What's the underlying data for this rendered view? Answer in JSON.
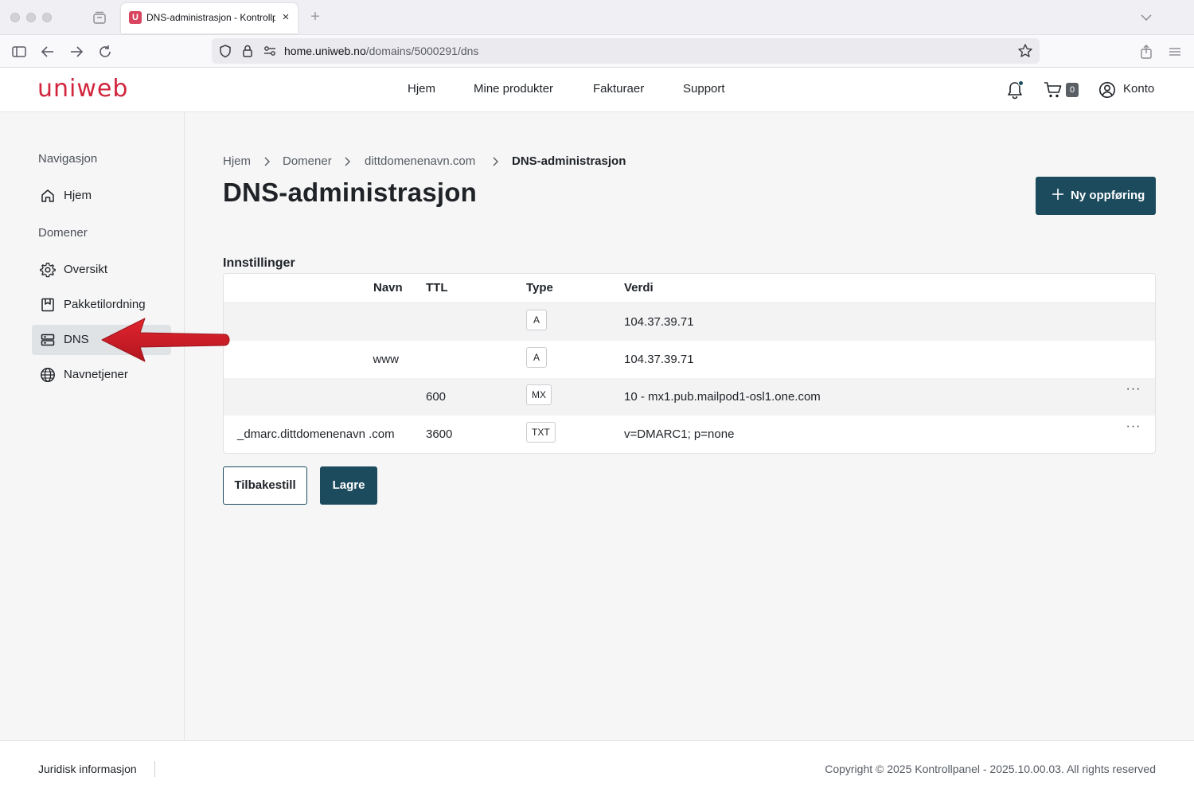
{
  "browser": {
    "tab_title": "DNS-administrasjon - Kontrollpanel",
    "tab_favicon_letter": "U",
    "new_tab_symbol": "+",
    "close_symbol": "×",
    "url_host": "home.uniweb.no",
    "url_path": "/domains/5000291/dns"
  },
  "header": {
    "logo": "uniweb",
    "nav": [
      "Hjem",
      "Mine produkter",
      "Fakturaer",
      "Support"
    ],
    "cart_count": "0",
    "account_label": "Konto"
  },
  "sidebar": {
    "section_nav": "Navigasjon",
    "home_label": "Hjem",
    "section_domains": "Domener",
    "items": [
      {
        "label": "Oversikt",
        "icon": "gear-icon"
      },
      {
        "label": "Pakketilordning",
        "icon": "package-icon"
      },
      {
        "label": "DNS",
        "icon": "server-icon",
        "active": true
      },
      {
        "label": "Navnetjener",
        "icon": "globe-icon"
      }
    ]
  },
  "breadcrumb": [
    "Hjem",
    "Domener",
    "dittdomenenavn.com",
    "DNS-administrasjon"
  ],
  "page_title": "DNS-administrasjon",
  "new_record_label": "Ny oppføring",
  "section_title": "Innstillinger",
  "table": {
    "headers": {
      "name": "Navn",
      "ttl": "TTL",
      "type": "Type",
      "value": "Verdi"
    },
    "rows": [
      {
        "name": "",
        "ttl": "",
        "type": "A",
        "value": "104.37.39.71",
        "menu": ""
      },
      {
        "name": "www",
        "ttl": "",
        "type": "A",
        "value": "104.37.39.71",
        "menu": ""
      },
      {
        "name": "",
        "ttl": "600",
        "type": "MX",
        "value": "10 - mx1.pub.mailpod1-osl1.one.com",
        "menu": "···"
      },
      {
        "name": "_dmarc.dittdomenenavn .com",
        "ttl": "3600",
        "type": "TXT",
        "value": "v=DMARC1; p=none",
        "menu": "···"
      }
    ]
  },
  "buttons": {
    "reset": "Tilbakestill",
    "save": "Lagre"
  },
  "footer": {
    "legal": "Juridisk informasjon",
    "copyright": "Copyright © 2025 Kontrollpanel - 2025.10.00.03. All rights reserved"
  },
  "colors": {
    "brand_red": "#d1263d",
    "primary": "#1c4b5e",
    "arrow_red": "#d0101c"
  }
}
